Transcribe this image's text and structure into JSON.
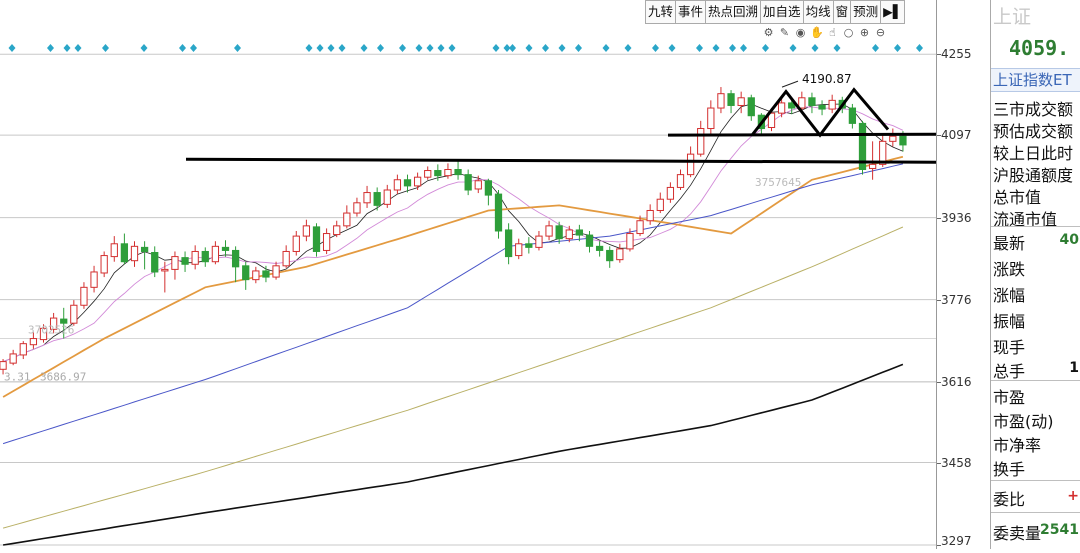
{
  "toolbar": {
    "buttons": [
      "九转",
      "事件",
      "热点回溯",
      "加自选",
      "均线",
      "窗",
      "预测"
    ]
  },
  "icons": [
    "gear-icon",
    "brush-icon",
    "eye-icon",
    "hand-icon",
    "hand-pointer-icon",
    "circle-icon",
    "zoom-in-icon",
    "zoom-out-icon"
  ],
  "panel": {
    "title": "上证",
    "price": "4059.",
    "tab": "上证指数ET",
    "rows": [
      "三市成交额",
      "预估成交额",
      "较上日此时",
      "沪股通额度",
      "总市值",
      "流通市值",
      "最新",
      "涨跌",
      "涨幅",
      "振幅",
      "现手",
      "总手",
      "市盈",
      "市盈(动)",
      "市净率",
      "换手",
      "委比",
      "委卖量"
    ],
    "values": {
      "latest": "40",
      "total_hands": "1",
      "commission_ratio": "+",
      "ask_volume": "2541"
    },
    "colors": {
      "price": "#2e7d32",
      "up": "#d32f2f",
      "down": "#2e7d32"
    }
  },
  "chart_data": {
    "type": "candlestick",
    "yticks": [
      3297,
      3458,
      3616,
      3776,
      3936,
      4097,
      4255
    ],
    "ylim": [
      3297,
      4275
    ],
    "annotations": {
      "max_label": "4190.87",
      "min_label_left": "3.31",
      "min_label_value": "3686.97",
      "overlay_text_1": "3702526",
      "overlay_text_2": "3757645"
    },
    "trendlines": [
      {
        "name": "neckline-upper",
        "value": 4097
      },
      {
        "name": "neckline-lower",
        "value": 4048
      }
    ],
    "double_top": [
      [
        4012,
        4097
      ],
      [
        4083,
        4182
      ],
      [
        4106,
        4097
      ],
      [
        4126,
        4186
      ],
      [
        4150,
        4108
      ]
    ],
    "candles": [
      [
        3640,
        3655,
        3630,
        3660
      ],
      [
        3652,
        3670,
        3648,
        3678
      ],
      [
        3668,
        3690,
        3660,
        3695
      ],
      [
        3688,
        3700,
        3680,
        3712
      ],
      [
        3698,
        3720,
        3692,
        3728
      ],
      [
        3718,
        3740,
        3710,
        3750
      ],
      [
        3738,
        3730,
        3700,
        3760
      ],
      [
        3730,
        3765,
        3725,
        3775
      ],
      [
        3765,
        3800,
        3758,
        3810
      ],
      [
        3800,
        3830,
        3790,
        3842
      ],
      [
        3828,
        3862,
        3820,
        3870
      ],
      [
        3860,
        3885,
        3850,
        3900
      ],
      [
        3885,
        3850,
        3845,
        3905
      ],
      [
        3852,
        3880,
        3840,
        3890
      ],
      [
        3878,
        3870,
        3835,
        3890
      ],
      [
        3868,
        3830,
        3820,
        3880
      ],
      [
        3832,
        3835,
        3790,
        3850
      ],
      [
        3835,
        3860,
        3815,
        3870
      ],
      [
        3858,
        3845,
        3830,
        3870
      ],
      [
        3845,
        3870,
        3835,
        3882
      ],
      [
        3870,
        3850,
        3840,
        3878
      ],
      [
        3850,
        3880,
        3845,
        3890
      ],
      [
        3878,
        3872,
        3860,
        3892
      ],
      [
        3872,
        3840,
        3810,
        3880
      ],
      [
        3842,
        3815,
        3795,
        3850
      ],
      [
        3815,
        3832,
        3808,
        3840
      ],
      [
        3832,
        3820,
        3810,
        3842
      ],
      [
        3820,
        3842,
        3815,
        3850
      ],
      [
        3842,
        3870,
        3838,
        3882
      ],
      [
        3870,
        3900,
        3862,
        3910
      ],
      [
        3900,
        3920,
        3890,
        3932
      ],
      [
        3918,
        3870,
        3860,
        3925
      ],
      [
        3872,
        3905,
        3865,
        3915
      ],
      [
        3903,
        3920,
        3898,
        3930
      ],
      [
        3920,
        3945,
        3915,
        3960
      ],
      [
        3945,
        3965,
        3938,
        3975
      ],
      [
        3965,
        3985,
        3955,
        3998
      ],
      [
        3985,
        3960,
        3950,
        3995
      ],
      [
        3962,
        3990,
        3955,
        4000
      ],
      [
        3990,
        4010,
        3982,
        4020
      ],
      [
        4010,
        3998,
        3985,
        4020
      ],
      [
        3998,
        4015,
        3990,
        4024
      ],
      [
        4015,
        4028,
        4010,
        4036
      ],
      [
        4028,
        4018,
        4008,
        4040
      ],
      [
        4018,
        4030,
        4012,
        4042
      ],
      [
        4030,
        4020,
        4010,
        4050
      ],
      [
        4020,
        3990,
        3980,
        4030
      ],
      [
        3992,
        4008,
        3984,
        4018
      ],
      [
        4008,
        3980,
        3960,
        4012
      ],
      [
        3982,
        3910,
        3895,
        3990
      ],
      [
        3912,
        3860,
        3845,
        3925
      ],
      [
        3862,
        3885,
        3855,
        3895
      ],
      [
        3885,
        3878,
        3866,
        3898
      ],
      [
        3878,
        3900,
        3872,
        3910
      ],
      [
        3900,
        3920,
        3892,
        3930
      ],
      [
        3920,
        3895,
        3885,
        3928
      ],
      [
        3895,
        3912,
        3888,
        3920
      ],
      [
        3912,
        3902,
        3890,
        3922
      ],
      [
        3902,
        3880,
        3868,
        3910
      ],
      [
        3880,
        3872,
        3860,
        3890
      ],
      [
        3872,
        3852,
        3838,
        3880
      ],
      [
        3854,
        3875,
        3848,
        3885
      ],
      [
        3875,
        3905,
        3870,
        3915
      ],
      [
        3905,
        3930,
        3900,
        3940
      ],
      [
        3930,
        3950,
        3922,
        3962
      ],
      [
        3950,
        3972,
        3945,
        3985
      ],
      [
        3972,
        3995,
        3965,
        4005
      ],
      [
        3995,
        4020,
        3990,
        4030
      ],
      [
        4020,
        4060,
        4015,
        4075
      ],
      [
        4060,
        4110,
        4055,
        4125
      ],
      [
        4110,
        4150,
        4100,
        4165
      ],
      [
        4150,
        4178,
        4140,
        4191
      ],
      [
        4178,
        4155,
        4140,
        4185
      ],
      [
        4155,
        4170,
        4140,
        4182
      ],
      [
        4170,
        4135,
        4125,
        4176
      ],
      [
        4136,
        4110,
        4098,
        4140
      ],
      [
        4112,
        4140,
        4105,
        4150
      ],
      [
        4140,
        4160,
        4132,
        4172
      ],
      [
        4160,
        4150,
        4138,
        4170
      ],
      [
        4150,
        4170,
        4142,
        4182
      ],
      [
        4170,
        4155,
        4140,
        4180
      ],
      [
        4155,
        4148,
        4136,
        4165
      ],
      [
        4148,
        4165,
        4140,
        4176
      ],
      [
        4165,
        4150,
        4140,
        4172
      ],
      [
        4150,
        4120,
        4110,
        4158
      ],
      [
        4120,
        4030,
        4020,
        4125
      ],
      [
        4032,
        4040,
        4010,
        4085
      ],
      [
        4040,
        4085,
        4035,
        4098
      ],
      [
        4085,
        4095,
        4075,
        4110
      ],
      [
        4095,
        4078,
        4065,
        4105
      ]
    ],
    "moving_averages": [
      {
        "name": "ma5",
        "color": "#222222",
        "values": []
      },
      {
        "name": "ma10",
        "color": "#d28ad8",
        "values": []
      },
      {
        "name": "ma20",
        "color": "#e39a40",
        "values": []
      },
      {
        "name": "ma60",
        "color": "#4a56c8",
        "values": []
      },
      {
        "name": "ma120",
        "color": "#b9b066",
        "values": []
      },
      {
        "name": "ma250",
        "color": "#111111",
        "values": []
      }
    ],
    "ma_anchor_points": {
      "ma20": [
        [
          0,
          3586
        ],
        [
          10,
          3700
        ],
        [
          20,
          3800
        ],
        [
          30,
          3840
        ],
        [
          40,
          3900
        ],
        [
          48,
          3950
        ],
        [
          55,
          3960
        ],
        [
          65,
          3928
        ],
        [
          72,
          3905
        ],
        [
          80,
          4010
        ],
        [
          91,
          4065
        ]
      ],
      "ma60": [
        [
          0,
          3495
        ],
        [
          20,
          3620
        ],
        [
          40,
          3760
        ],
        [
          50,
          3880
        ],
        [
          60,
          3900
        ],
        [
          70,
          3940
        ],
        [
          80,
          4000
        ],
        [
          91,
          4050
        ]
      ],
      "ma120": [
        [
          0,
          3330
        ],
        [
          20,
          3440
        ],
        [
          40,
          3560
        ],
        [
          55,
          3660
        ],
        [
          70,
          3760
        ],
        [
          80,
          3840
        ],
        [
          91,
          3935
        ]
      ],
      "ma250": [
        [
          0,
          3297
        ],
        [
          20,
          3360
        ],
        [
          40,
          3420
        ],
        [
          55,
          3480
        ],
        [
          70,
          3530
        ],
        [
          80,
          3580
        ],
        [
          91,
          3665
        ]
      ]
    },
    "markers": [
      0,
      7,
      10,
      12,
      17,
      24,
      31,
      33,
      41,
      54,
      56,
      58,
      60,
      64,
      67,
      71,
      74,
      76,
      78,
      80,
      88,
      90,
      91,
      94,
      97,
      100,
      103,
      108,
      112,
      117,
      120,
      125,
      128,
      131,
      133,
      137,
      142,
      146,
      150,
      157,
      161,
      165
    ]
  }
}
